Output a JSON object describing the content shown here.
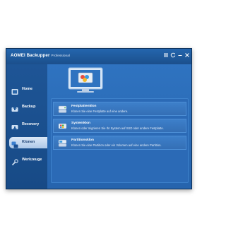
{
  "window": {
    "app_name": "AOMEI Backupper",
    "edition": "Professional",
    "buttons": [
      "menu-icon",
      "refresh-icon",
      "minimize-icon",
      "close-icon"
    ]
  },
  "sidebar": {
    "items": [
      {
        "label": "Home",
        "icon": "home-icon",
        "active": false
      },
      {
        "label": "Backup",
        "icon": "backup-icon",
        "active": false
      },
      {
        "label": "Recovery",
        "icon": "recovery-icon",
        "active": false
      },
      {
        "label": "Klonen",
        "icon": "clone-icon",
        "active": true
      },
      {
        "label": "Werkzeuge",
        "icon": "tools-icon",
        "active": false
      }
    ]
  },
  "main": {
    "options": [
      {
        "title": "Festplattenklon",
        "description": "Klonen Sie eine Festplatte auf eine andere.",
        "icon": "disk-clone-icon"
      },
      {
        "title": "Systemklon",
        "description": "Klonen oder migrieren Sie Ihr System auf SSD oder andere Festplatte.",
        "icon": "system-clone-icon"
      },
      {
        "title": "Partitionsklon",
        "description": "Klonen Sie eine Partition oder ein Volumen auf eine andere Partition.",
        "icon": "partition-clone-icon"
      }
    ]
  },
  "colors": {
    "window_bg": "#1f5a9c",
    "main_bg": "#2f73c0",
    "active_tab": "#dbe8f7"
  }
}
